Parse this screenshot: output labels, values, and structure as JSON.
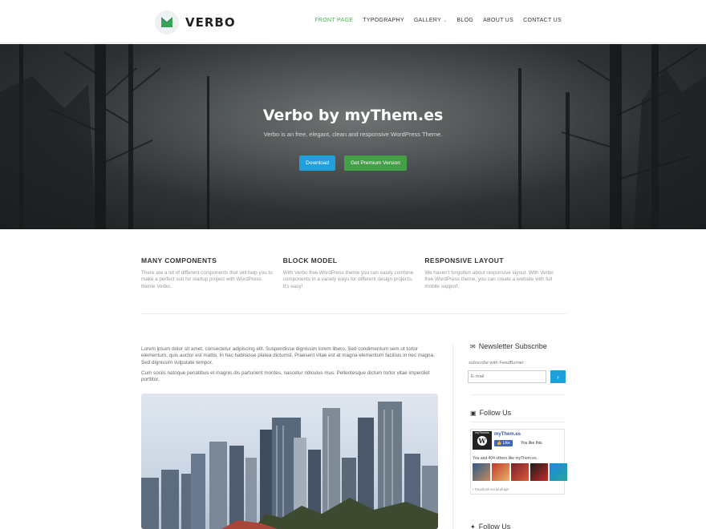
{
  "brand": {
    "name": "VERBO",
    "accent": "#4caf50"
  },
  "nav": {
    "items": [
      {
        "label": "FRONT PAGE",
        "active": true
      },
      {
        "label": "TYPOGRAPHY"
      },
      {
        "label": "GALLERY",
        "has_dropdown": true
      },
      {
        "label": "BLOG"
      },
      {
        "label": "ABOUT US"
      },
      {
        "label": "CONTACT US"
      }
    ]
  },
  "hero": {
    "title": "Verbo by myThem.es",
    "subtitle": "Verbo is an free, elegant, clean and responsive WordPress Theme.",
    "primary_button": "Download",
    "secondary_button": "Get Premium Version",
    "primary_color": "#1fa0dc",
    "secondary_color": "#43a047"
  },
  "features": [
    {
      "title": "MANY COMPONENTS",
      "text": "There are a lot of different components that will help you to make a perfect suit for startup project with WordPress theme Verbo."
    },
    {
      "title": "BLOCK MODEL",
      "text": "With Verbo free WordPress theme you can easily combine components in a variety ways for different design projects. It's easy!"
    },
    {
      "title": "RESPONSIVE LAYOUT",
      "text": "We haven't forgotten about responsive layout. With Verbo free WordPress theme, you can create a website with full mobile support."
    }
  ],
  "content": {
    "paragraph_1": "Lorem ipsum dolor sit amet, consectetur adipiscing elit. Suspendisse dignissim lorem libero. Sed condimentum sem ut tortor elementum, quis auctor est mattis. In hac habitasse platea dictumst. Praesent vitae est at magna elementum facilisis in nec magna. Sed dignissim vulputate tempor.",
    "paragraph_2": "Cum sociis natoque penatibus et magnis dis parturient montes, nascetur ridiculus mus. Pellentesque dictum tortor vitae imperdiet porttitor."
  },
  "sidebar": {
    "newsletter": {
      "title": "Newsletter Subscribe",
      "icon": "envelope-icon",
      "note": "subscribe with FeedBurner",
      "placeholder": "E-mail",
      "submit_icon": "›"
    },
    "follow": {
      "title": "Follow Us",
      "icon": "facebook-icon",
      "page_name": "myThem.es",
      "logo_caption": "myThemes",
      "like_label": "Like",
      "like_text": "You like this.",
      "others_text": "You and 404 others like myThem.es.",
      "plugin_text": "Facebook social plugin"
    },
    "follow_2": {
      "title": "Follow Us",
      "icon": "twitter-icon"
    }
  }
}
